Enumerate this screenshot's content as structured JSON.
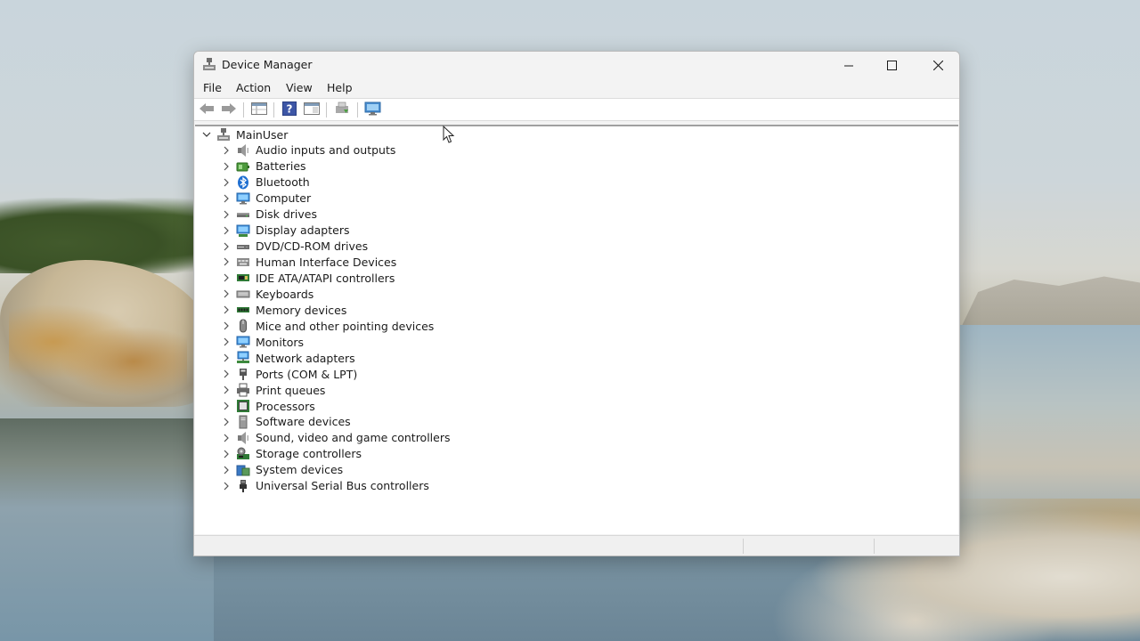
{
  "window": {
    "title": "Device Manager",
    "controls": {
      "minimize": "minimize-icon",
      "maximize": "maximize-icon",
      "close": "close-icon"
    }
  },
  "menu": [
    "File",
    "Action",
    "View",
    "Help"
  ],
  "toolbar": {
    "buttons": [
      "back-arrow-icon",
      "forward-arrow-icon",
      "properties-grid-icon",
      "help-icon",
      "action-pane-icon",
      "update-driver-icon",
      "scan-hardware-icon"
    ]
  },
  "tree": {
    "root": "MainUser",
    "items": [
      {
        "label": "Audio inputs and outputs",
        "icon": "speaker-icon"
      },
      {
        "label": "Batteries",
        "icon": "battery-icon"
      },
      {
        "label": "Bluetooth",
        "icon": "bluetooth-icon"
      },
      {
        "label": "Computer",
        "icon": "computer-icon"
      },
      {
        "label": "Disk drives",
        "icon": "disk-drive-icon"
      },
      {
        "label": "Display adapters",
        "icon": "display-adapter-icon"
      },
      {
        "label": "DVD/CD-ROM drives",
        "icon": "dvd-drive-icon"
      },
      {
        "label": "Human Interface Devices",
        "icon": "hid-icon"
      },
      {
        "label": "IDE ATA/ATAPI controllers",
        "icon": "ide-controller-icon"
      },
      {
        "label": "Keyboards",
        "icon": "keyboard-icon"
      },
      {
        "label": "Memory devices",
        "icon": "memory-icon"
      },
      {
        "label": "Mice and other pointing devices",
        "icon": "mouse-icon"
      },
      {
        "label": "Monitors",
        "icon": "monitor-icon"
      },
      {
        "label": "Network adapters",
        "icon": "network-adapter-icon"
      },
      {
        "label": "Ports (COM & LPT)",
        "icon": "port-icon"
      },
      {
        "label": "Print queues",
        "icon": "printer-icon"
      },
      {
        "label": "Processors",
        "icon": "processor-icon"
      },
      {
        "label": "Software devices",
        "icon": "software-device-icon"
      },
      {
        "label": "Sound, video and game controllers",
        "icon": "sound-controller-icon"
      },
      {
        "label": "Storage controllers",
        "icon": "storage-controller-icon"
      },
      {
        "label": "System devices",
        "icon": "system-devices-icon"
      },
      {
        "label": "Universal Serial Bus controllers",
        "icon": "usb-icon"
      }
    ]
  },
  "colors": {
    "accent": "#2b7cd3",
    "window_bg": "#f3f3f3",
    "pane_bg": "#ffffff",
    "text": "#1b1b1b"
  }
}
